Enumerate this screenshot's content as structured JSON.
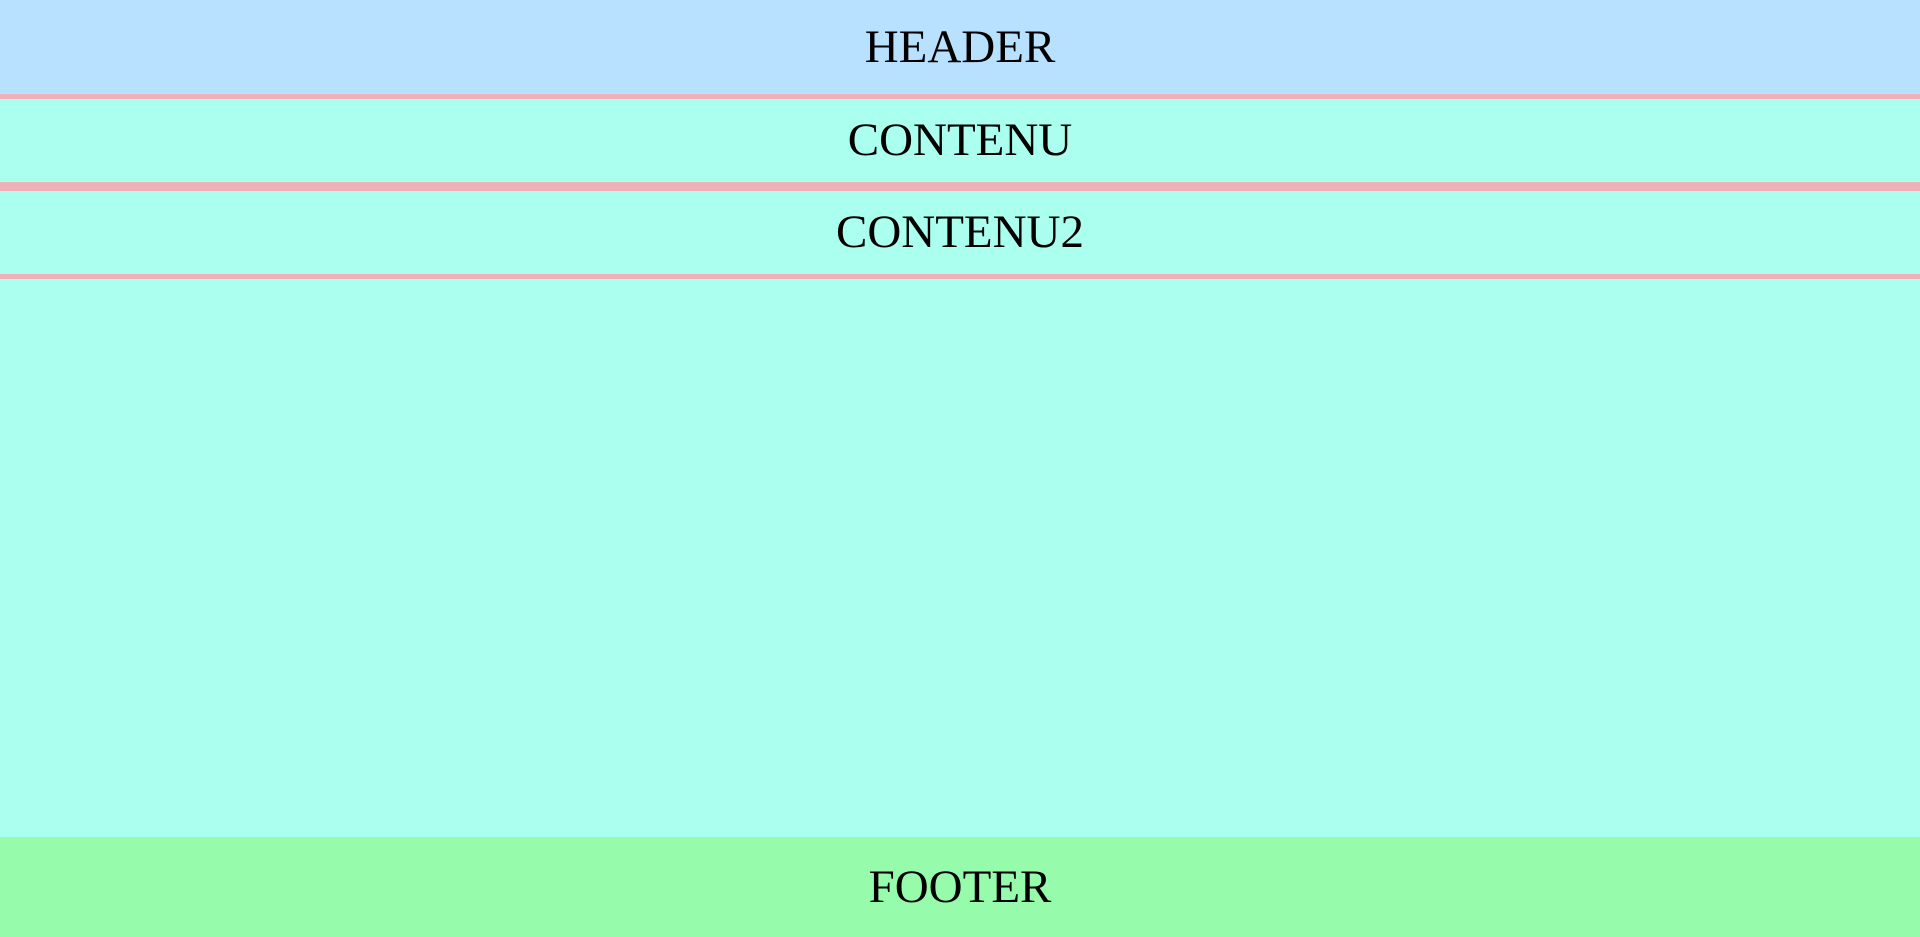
{
  "header": {
    "text": "HEADER"
  },
  "content": {
    "text": "CONTENU"
  },
  "content2": {
    "text": "CONTENU2"
  },
  "footer": {
    "text": "FOOTER"
  },
  "colors": {
    "header_bg": "#b8e0ff",
    "content_bg": "#aaffee",
    "divider": "#f0b0b8",
    "footer_bg": "#96fcac"
  }
}
